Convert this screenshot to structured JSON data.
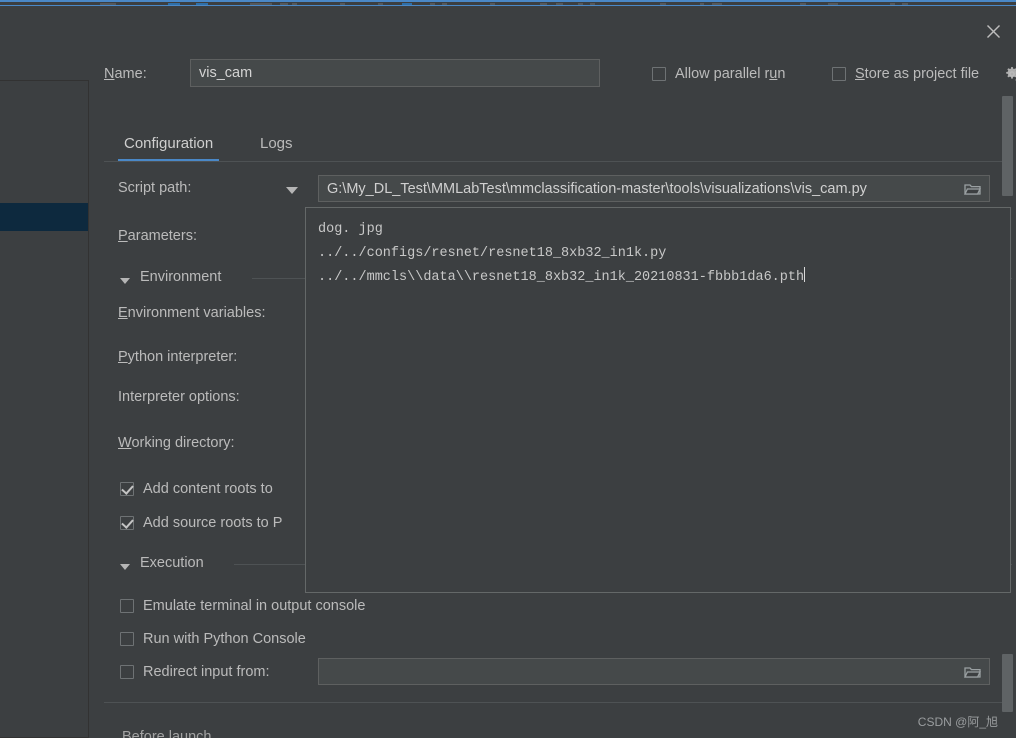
{
  "window": {
    "close_label": "✕"
  },
  "name_row": {
    "label_mnemonic": "N",
    "label_rest": "ame:",
    "value": "vis_cam",
    "placeholder": "",
    "allow_parallel_run": {
      "label_pre": "Allow parallel r",
      "label_mnemonic": "u",
      "label_post": "n",
      "checked": false
    },
    "store_as_project_file": {
      "label_mnemonic": "S",
      "label_rest": "tore as project file",
      "checked": false
    },
    "gear_icon": "gear-icon"
  },
  "tabs": [
    {
      "label": "Configuration",
      "active": true
    },
    {
      "label": "Logs",
      "active": false
    }
  ],
  "form": {
    "script_path": {
      "label": "Script path:",
      "value": "G:\\My_DL_Test\\MMLabTest\\mmclassification-master\\tools\\visualizations\\vis_cam.py",
      "browse_icon": "folder-icon",
      "dropdown_icon": "chevron-down-icon"
    },
    "parameters": {
      "label_mnemonic": "P",
      "label_rest": "arameters:",
      "lines": [
        "dog. jpg",
        "../../configs/resnet/resnet18_8xb32_in1k.py",
        "../../mmcls\\\\data\\\\resnet18_8xb32_in1k_20210831-fbbb1da6.pth"
      ]
    },
    "environment_section": {
      "title": "Environment",
      "collapsed": false
    },
    "environment_variables": {
      "label_mnemonic": "E",
      "label_rest": "nvironment variables:"
    },
    "python_interpreter": {
      "label_mnemonic": "P",
      "label_rest": "ython interpreter:"
    },
    "interpreter_options": {
      "label": "Interpreter options:"
    },
    "working_directory": {
      "label_mnemonic": "W",
      "label_rest": "orking directory:"
    },
    "add_content_roots": {
      "label": "Add content roots to",
      "checked": true
    },
    "add_source_roots": {
      "label": "Add source roots to P",
      "checked": true
    },
    "execution_section": {
      "title": "Execution",
      "collapsed": false
    },
    "emulate_terminal": {
      "label": "Emulate terminal in output console",
      "checked": false
    },
    "run_with_python_console": {
      "label": "Run with Python Console",
      "checked": false
    },
    "redirect_input_from": {
      "label": "Redirect input from:",
      "checked": false,
      "value": "",
      "browse_icon": "folder-icon"
    },
    "before_launch_ghost": "Before launch"
  },
  "watermark": "CSDN @阿_旭",
  "colors": {
    "background": "#3c3f41",
    "field_background": "#45494a",
    "accent_blue": "#4a88c7",
    "selection_blue": "#0d293e",
    "text": "#bbbbbb",
    "border": "#5e6060"
  }
}
